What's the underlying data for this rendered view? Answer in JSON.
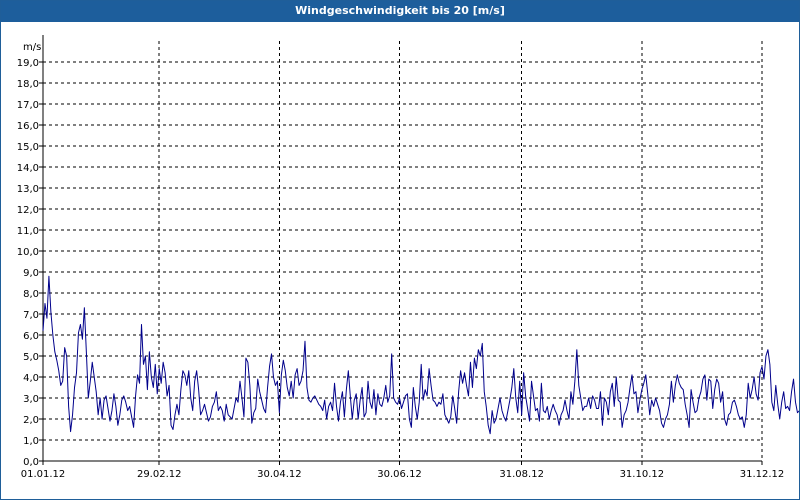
{
  "window": {
    "title": "Windgeschwindigkeit bis 20 [m/s]"
  },
  "chart_data": {
    "type": "line",
    "title": "Windgeschwindigkeit bis 20 [m/s]",
    "ylabel": "m/s",
    "xlabel": "",
    "ylim": [
      0,
      20
    ],
    "xlim": [
      "2012-01-01",
      "2012-12-31"
    ],
    "grid": true,
    "y_ticks": [
      "0,0",
      "1,0",
      "2,0",
      "3,0",
      "4,0",
      "5,0",
      "6,0",
      "7,0",
      "8,0",
      "9,0",
      "10,0",
      "11,0",
      "12,0",
      "13,0",
      "14,0",
      "15,0",
      "16,0",
      "17,0",
      "18,0",
      "19,0"
    ],
    "x_ticks": [
      {
        "date": "2012-01-01",
        "label": "01.01.12"
      },
      {
        "date": "2012-02-29",
        "label": "29.02.12"
      },
      {
        "date": "2012-04-30",
        "label": "30.04.12"
      },
      {
        "date": "2012-06-30",
        "label": "30.06.12"
      },
      {
        "date": "2012-08-31",
        "label": "31.08.12"
      },
      {
        "date": "2012-10-31",
        "label": "31.10.12"
      },
      {
        "date": "2012-12-31",
        "label": "31.12.12"
      }
    ],
    "series": [
      {
        "color": "#00008b",
        "start_date": "2012-01-01",
        "step_days": 1,
        "values": [
          6.2,
          7.5,
          6.8,
          8.8,
          7.1,
          6.0,
          5.2,
          4.8,
          4.3,
          3.6,
          3.8,
          5.4,
          5.0,
          2.6,
          1.4,
          2.2,
          3.5,
          4.2,
          6.1,
          6.5,
          5.8,
          7.3,
          5.2,
          3.0,
          3.8,
          4.7,
          4.0,
          3.3,
          2.2,
          3.0,
          2.0,
          2.9,
          3.1,
          2.5,
          1.9,
          2.4,
          3.2,
          2.6,
          1.7,
          2.2,
          2.9,
          3.1,
          2.8,
          2.4,
          2.6,
          2.1,
          1.6,
          3.1,
          4.1,
          3.7,
          6.5,
          4.6,
          5.0,
          3.4,
          5.2,
          4.0,
          3.5,
          4.6,
          3.2,
          4.4,
          3.7,
          4.7,
          4.2,
          3.1,
          3.6,
          1.7,
          1.5,
          2.2,
          2.7,
          2.2,
          3.4,
          4.3,
          4.1,
          3.6,
          4.3,
          3.0,
          2.4,
          3.8,
          4.3,
          3.4,
          2.2,
          2.4,
          2.7,
          2.3,
          1.9,
          2.1,
          2.6,
          2.8,
          3.3,
          2.4,
          2.6,
          2.4,
          1.9,
          2.7,
          2.2,
          2.1,
          2.0,
          2.5,
          3.0,
          2.8,
          3.8,
          3.0,
          2.1,
          4.9,
          4.7,
          3.6,
          1.8,
          2.3,
          2.5,
          3.9,
          3.3,
          2.9,
          2.5,
          2.3,
          3.5,
          4.5,
          5.1,
          4.0,
          3.6,
          3.8,
          2.3,
          4.1,
          4.8,
          4.3,
          3.5,
          3.1,
          3.8,
          3.0,
          4.1,
          4.4,
          3.6,
          3.8,
          4.3,
          5.7,
          3.5,
          2.9,
          2.8,
          3.0,
          3.1,
          2.9,
          2.7,
          2.6,
          2.4,
          2.9,
          2.0,
          2.6,
          2.8,
          2.4,
          3.7,
          2.6,
          1.9,
          2.8,
          3.3,
          2.1,
          3.4,
          4.3,
          3.1,
          2.0,
          2.9,
          3.2,
          2.0,
          2.9,
          3.5,
          2.1,
          2.3,
          3.8,
          2.8,
          2.5,
          3.4,
          2.2,
          3.2,
          2.7,
          2.6,
          3.0,
          3.6,
          2.8,
          3.1,
          5.1,
          3.0,
          2.8,
          2.7,
          3.0,
          2.5,
          2.8,
          3.1,
          3.2,
          2.0,
          1.6,
          3.5,
          2.6,
          2.0,
          2.8,
          4.6,
          2.9,
          3.4,
          3.1,
          4.4,
          3.6,
          2.9,
          2.8,
          2.6,
          2.8,
          2.7,
          3.2,
          2.2,
          2.0,
          1.8,
          2.1,
          3.1,
          2.5,
          1.8,
          3.3,
          4.3,
          3.7,
          4.2,
          3.6,
          3.1,
          4.7,
          3.5,
          4.9,
          4.4,
          5.3,
          5.0,
          5.6,
          3.3,
          2.6,
          1.7,
          1.3,
          2.4,
          1.8,
          2.0,
          2.5,
          3.0,
          2.4,
          2.1,
          1.9,
          2.4,
          2.9,
          3.5,
          4.4,
          3.0,
          2.3,
          3.8,
          2.2,
          4.2,
          3.1,
          2.5,
          1.9,
          3.8,
          3.1,
          2.4,
          2.5,
          1.9,
          3.7,
          2.4,
          2.3,
          2.6,
          2.0,
          2.4,
          2.7,
          2.4,
          2.2,
          1.7,
          2.2,
          2.4,
          2.9,
          2.4,
          2.0,
          3.3,
          2.7,
          3.8,
          5.3,
          3.6,
          3.0,
          2.4,
          2.6,
          2.6,
          3.0,
          2.5,
          3.1,
          2.9,
          2.5,
          2.5,
          3.3,
          1.7,
          3.0,
          2.8,
          2.2,
          3.3,
          3.7,
          2.6,
          4.0,
          2.9,
          2.8,
          1.6,
          2.2,
          2.4,
          2.8,
          3.5,
          4.1,
          3.2,
          3.3,
          2.3,
          2.9,
          3.4,
          3.7,
          4.1,
          3.2,
          2.2,
          2.9,
          2.6,
          3.0,
          2.7,
          2.4,
          1.8,
          1.6,
          2.0,
          2.2,
          2.7,
          3.8,
          2.8,
          3.6,
          4.1,
          3.7,
          3.5,
          3.4,
          2.7,
          2.2,
          1.6,
          3.4,
          2.8,
          2.3,
          2.4,
          3.0,
          3.3,
          3.9,
          4.1,
          2.9,
          3.9,
          3.8,
          2.5,
          3.4,
          3.9,
          3.7,
          2.8,
          3.3,
          2.0,
          1.7,
          2.2,
          2.3,
          2.8,
          2.9,
          2.6,
          2.2,
          2.0,
          2.1,
          1.6,
          2.2,
          3.7,
          3.0,
          3.4,
          4.0,
          3.2,
          2.9,
          4.2,
          4.5,
          3.9,
          5.0,
          5.3,
          4.6,
          2.8,
          2.4,
          3.6,
          2.7,
          2.0,
          2.8,
          3.3,
          2.5,
          2.6,
          2.4,
          3.3,
          3.9,
          2.8,
          2.3,
          2.4,
          3.4,
          2.2,
          2.6,
          3.1,
          3.9,
          4.2,
          2.9,
          4.4,
          2.4,
          3.0,
          3.2,
          4.2,
          3.8,
          4.3,
          4.9,
          2.7,
          4.7,
          3.0,
          2.2,
          2.5,
          4.0,
          2.4,
          3.6,
          2.2,
          2.9,
          2.0,
          3.3,
          4.7,
          4.4,
          5.1,
          3.2,
          1.9,
          3.8,
          2.9,
          5.3,
          2.7,
          4.8,
          5.6,
          4.0,
          3.0,
          4.3,
          2.7,
          3.5,
          3.2,
          3.3,
          3.7,
          3.4,
          4.0,
          2.6,
          3.6,
          2.6,
          4.1,
          5.8,
          3.1,
          3.9,
          5.5,
          5.1,
          4.0,
          3.0,
          2.5,
          3.2,
          4.6,
          4.4,
          4.8,
          4.1,
          3.4,
          3.6,
          5.0,
          5.7,
          4.7,
          4.8,
          5.3,
          4.1,
          3.2,
          5.8,
          2.6,
          4.2,
          3.4,
          2.4,
          3.0,
          4.2,
          5.8
        ]
      }
    ]
  }
}
